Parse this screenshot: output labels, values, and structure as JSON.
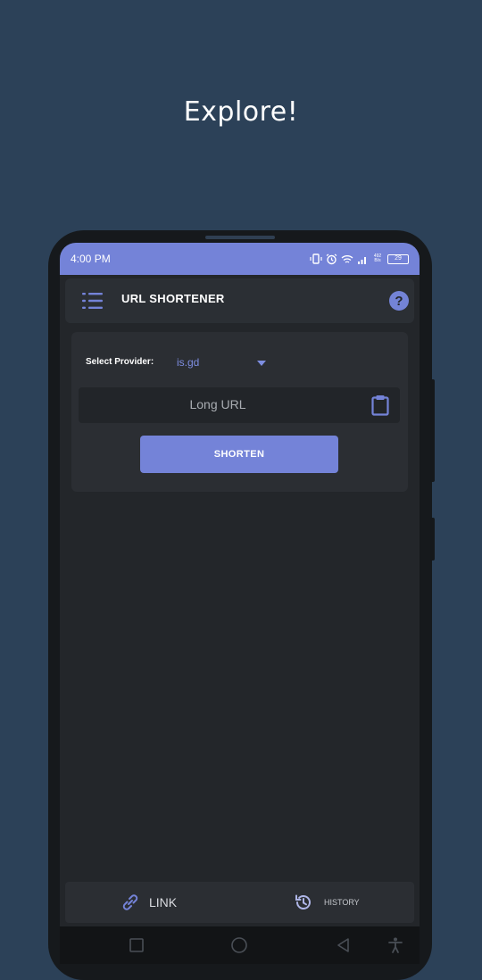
{
  "headline": "Explore!",
  "status_bar": {
    "time": "4:00 PM",
    "icons": [
      "vibrate-icon",
      "alarm-icon",
      "wifi-icon",
      "signal-icon",
      "network-speed-icon",
      "battery-icon"
    ],
    "battery_text": "29",
    "speed_text": "492 B/s"
  },
  "toolbar": {
    "title": "URL SHORTENER",
    "menu_icon": "menu-icon",
    "help_icon": "help-icon",
    "help_glyph": "?"
  },
  "form": {
    "provider_label": "Select Provider:",
    "provider_value": "is.gd",
    "url_placeholder": "Long URL",
    "shorten_label": "SHORTEN"
  },
  "bottom_nav": {
    "link_label": "LINK",
    "history_label": "HISTORY"
  },
  "colors": {
    "background": "#2c4158",
    "accent": "#7483d8",
    "surface": "#2b2e33",
    "screen": "#23262a"
  }
}
